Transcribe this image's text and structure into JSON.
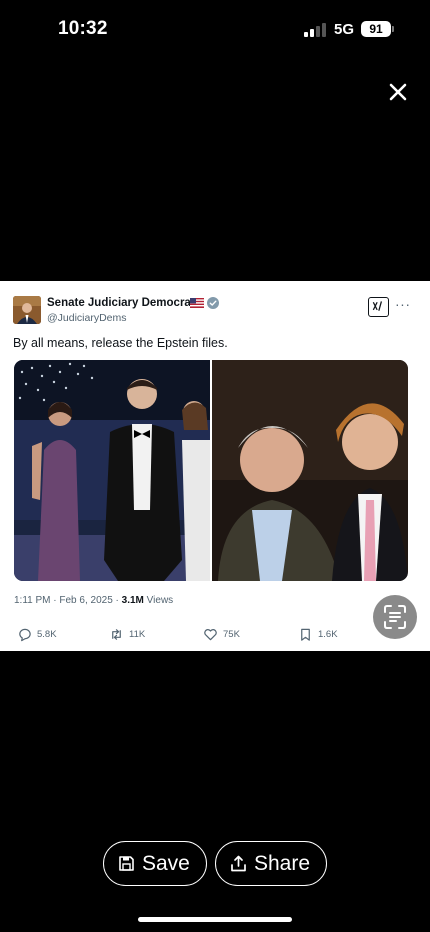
{
  "status_bar": {
    "time": "10:32",
    "network": "5G",
    "battery": "91"
  },
  "tweet": {
    "author_name": "Senate Judiciary Democrats",
    "author_handle": "@JudiciaryDems",
    "text": "By all means, release the Epstein files.",
    "timestamp": "1:11 PM · Feb 6, 2025 · ",
    "views_count": "3.1M",
    "views_label": " Views",
    "grok_label": "x/",
    "more_label": "···",
    "actions": {
      "replies": "5.8K",
      "reposts": "11K",
      "likes": "75K",
      "bookmarks": "1.6K"
    },
    "media": [
      {
        "icon": "photo-event-icon",
        "bg": "#1a2440"
      },
      {
        "icon": "photo-portrait-icon",
        "bg": "#1e1612"
      }
    ]
  },
  "controls": {
    "save_label": "Save",
    "share_label": "Share"
  },
  "colors": {
    "background": "#000000",
    "card": "#ffffff",
    "text_primary": "#0f1419",
    "text_secondary": "#536471",
    "verified": "#829aab"
  }
}
